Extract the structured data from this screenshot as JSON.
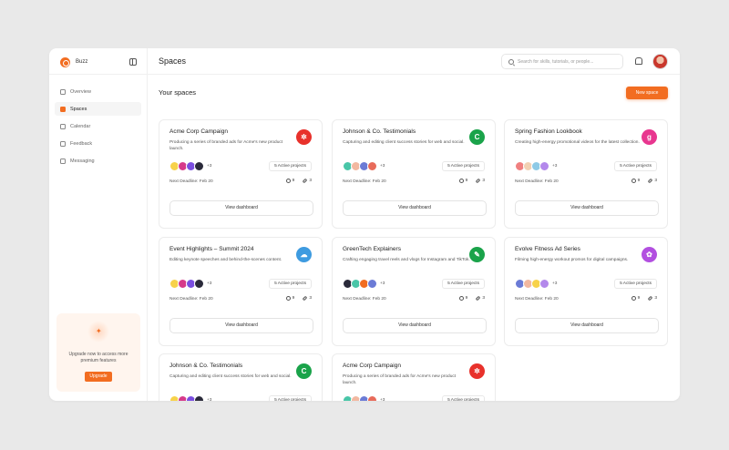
{
  "app": {
    "brand_name": "Buzz"
  },
  "sidebar": {
    "items": [
      {
        "label": "Overview",
        "icon": "grid-icon",
        "active": false
      },
      {
        "label": "Spaces",
        "icon": "folder-icon",
        "active": true
      },
      {
        "label": "Calendar",
        "icon": "calendar-icon",
        "active": false
      },
      {
        "label": "Feedback",
        "icon": "chat-icon",
        "active": false
      },
      {
        "label": "Messaging",
        "icon": "message-icon",
        "active": false
      }
    ],
    "upgrade": {
      "text": "Upgrade now to access more premium features",
      "button": "Upgrade",
      "icon": "sparkle-icon"
    }
  },
  "header": {
    "title": "Spaces",
    "search_placeholder": "Search for skills, tutorials, or people..."
  },
  "main": {
    "section_title": "Your spaces",
    "new_button": "New space",
    "cards": [
      {
        "title": "Acme Corp Campaign",
        "desc": "Producing a series of branded ads for Acme's new product launch.",
        "icon_char": "✲",
        "icon_color": "#e8312b",
        "more": "+3",
        "projects": "5 Active projects",
        "deadline": "Next Deadline: Feb 20",
        "comments": "9",
        "links": "3",
        "button": "View dashboard"
      },
      {
        "title": "Johnson & Co. Testimonials",
        "desc": "Capturing and editing client success stories for web and social.",
        "icon_char": "C",
        "icon_color": "#1aa34a",
        "more": "+3",
        "projects": "5 Active projects",
        "deadline": "Next Deadline: Feb 20",
        "comments": "9",
        "links": "3",
        "button": "View dashboard"
      },
      {
        "title": "Spring Fashion Lookbook",
        "desc": "Creating high-energy promotional videos for the latest collection.",
        "icon_char": "g",
        "icon_color": "#e8368f",
        "more": "+3",
        "projects": "5 Active projects",
        "deadline": "Next Deadline: Feb 20",
        "comments": "9",
        "links": "3",
        "button": "View dashboard"
      },
      {
        "title": "Event Highlights – Summit 2024",
        "desc": "Editing keynote speeches and behind-the-scenes content.",
        "icon_char": "☁",
        "icon_color": "#3e9be0",
        "more": "+3",
        "projects": "5 Active projects",
        "deadline": "Next Deadline: Feb 20",
        "comments": "9",
        "links": "3",
        "button": "View dashboard"
      },
      {
        "title": "GreenTech Explainers",
        "desc": "Crafting engaging travel reels and vlogs for Instagram and TikTok.",
        "icon_char": "✎",
        "icon_color": "#1aa34a",
        "more": "+3",
        "projects": "5 Active projects",
        "deadline": "Next Deadline: Feb 20",
        "comments": "9",
        "links": "3",
        "button": "View dashboard"
      },
      {
        "title": "Evolve Fitness Ad Series",
        "desc": "Filming high-energy workout promos for digital campaigns.",
        "icon_char": "✿",
        "icon_color": "#b24fe0",
        "more": "+3",
        "projects": "5 Active projects",
        "deadline": "Next Deadline: Feb 20",
        "comments": "9",
        "links": "3",
        "button": "View dashboard"
      },
      {
        "title": "Johnson & Co. Testimonials",
        "desc": "Capturing and editing client success stories for web and social.",
        "icon_char": "C",
        "icon_color": "#1aa34a",
        "more": "+3",
        "projects": "5 Active projects",
        "deadline": "",
        "comments": "",
        "links": "",
        "button": ""
      },
      {
        "title": "Acme Corp Campaign",
        "desc": "Producing a series of branded ads for Acme's new product launch.",
        "icon_char": "✲",
        "icon_color": "#e8312b",
        "more": "+3",
        "projects": "5 Active projects",
        "deadline": "",
        "comments": "",
        "links": "",
        "button": ""
      }
    ]
  }
}
